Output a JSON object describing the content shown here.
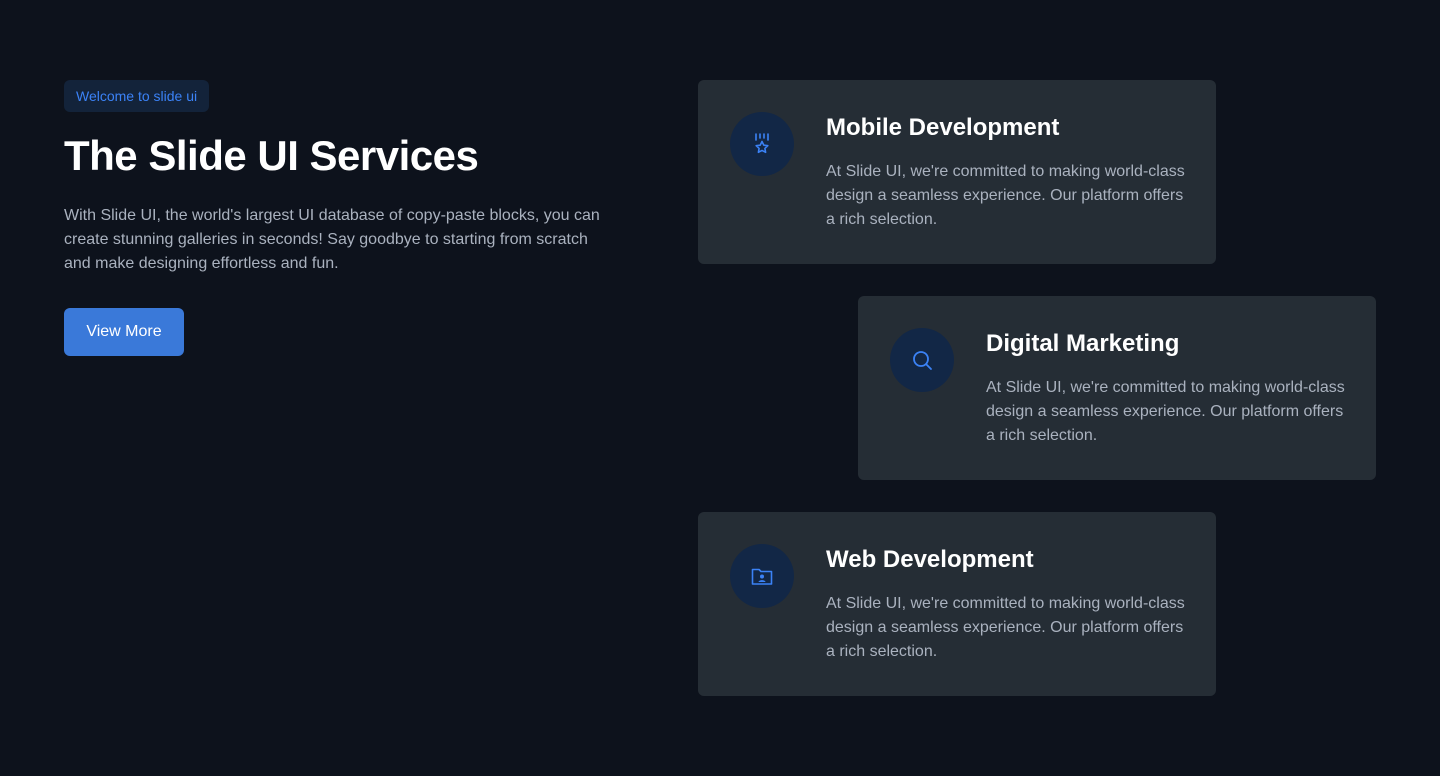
{
  "intro": {
    "badge": "Welcome to slide ui",
    "title": "The Slide UI Services",
    "description": "With Slide UI, the world's largest UI database of copy-paste blocks, you can create stunning galleries in seconds! Say goodbye to starting from scratch and make designing effortless and fun.",
    "button_label": "View More"
  },
  "services": [
    {
      "title": "Mobile Development",
      "text": "At Slide UI, we're committed to making world-class design a seamless experience. Our platform offers a rich selection.",
      "icon": "medal-icon"
    },
    {
      "title": "Digital Marketing",
      "text": "At Slide UI, we're committed to making world-class design a seamless experience. Our platform offers a rich selection.",
      "icon": "search-icon"
    },
    {
      "title": "Web Development",
      "text": "At Slide UI, we're committed to making world-class design a seamless experience. Our platform offers a rich selection.",
      "icon": "folder-user-icon"
    }
  ],
  "colors": {
    "background": "#0d121c",
    "card": "#252d35",
    "accent": "#3b82f6",
    "button": "#3a79d9",
    "icon_circle": "#122746"
  }
}
